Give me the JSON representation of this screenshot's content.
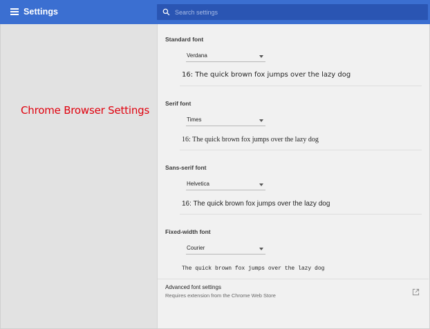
{
  "header": {
    "title": "Settings",
    "search_placeholder": "Search settings"
  },
  "sidebar": {
    "caption": "Chrome Browser Settings"
  },
  "fonts": {
    "standard": {
      "label": "Standard font",
      "selected": "Verdana",
      "preview": "16: The quick brown fox jumps over the lazy dog"
    },
    "serif": {
      "label": "Serif font",
      "selected": "Times",
      "preview": "16: The quick brown fox jumps over the lazy dog"
    },
    "sans_serif": {
      "label": "Sans-serif font",
      "selected": "Helvetica",
      "preview": "16: The quick brown fox jumps over the lazy dog"
    },
    "fixed_width": {
      "label": "Fixed-width font",
      "selected": "Courier",
      "preview": "The quick brown fox jumps over the lazy dog"
    }
  },
  "advanced": {
    "title": "Advanced font settings",
    "subtitle": "Requires extension from the Chrome Web Store"
  },
  "colors": {
    "header_bg": "#3b6fd1",
    "search_bg": "#2a55b3",
    "caption": "#e0000d"
  },
  "icons": {
    "menu": "menu-icon",
    "search": "search-icon",
    "external_link": "external-link-icon"
  }
}
